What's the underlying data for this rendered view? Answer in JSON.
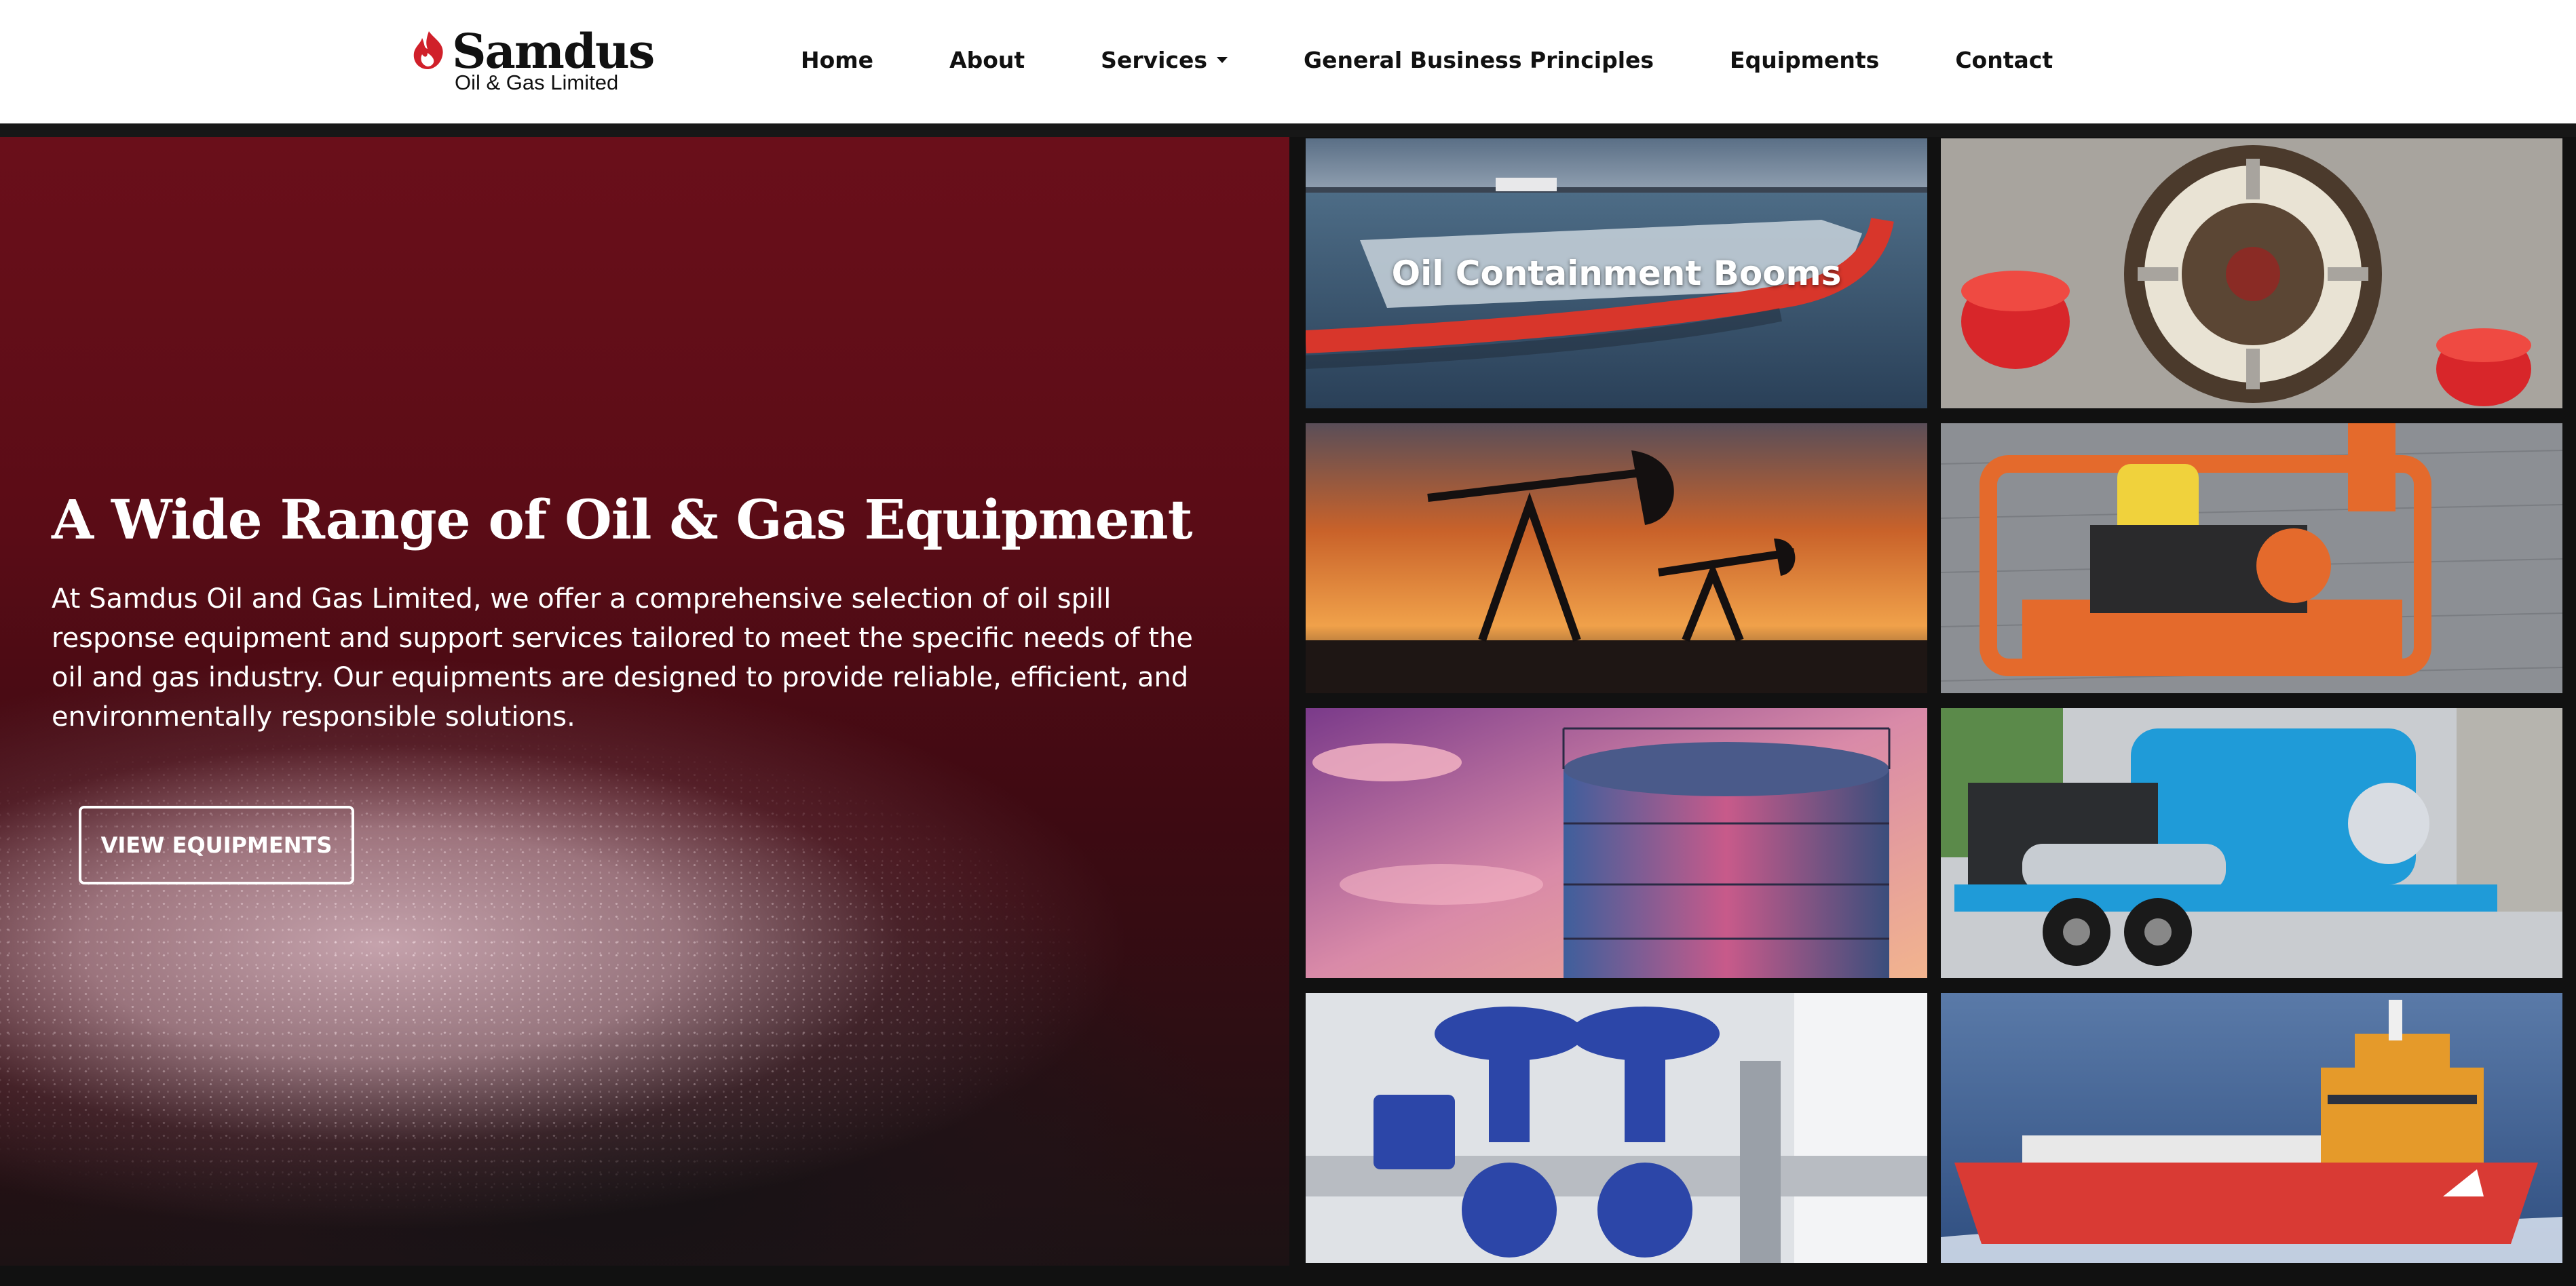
{
  "header": {
    "logo": {
      "name": "Samdus",
      "tagline": "Oil & Gas Limited"
    },
    "nav": [
      {
        "label": "Home"
      },
      {
        "label": "About"
      },
      {
        "label": "Services"
      },
      {
        "label": "General Business Principles"
      },
      {
        "label": "Equipments"
      },
      {
        "label": "Contact"
      }
    ]
  },
  "hero": {
    "title": "A Wide Range of Oil & Gas Equipment",
    "text": "At Samdus Oil and Gas Limited, we offer a comprehensive selection of oil spill response equipment and support services tailored to meet the specific needs of the oil and gas industry. Our equipments are designed to provide reliable, efficient, and environmentally responsible solutions.",
    "button_label": "VIEW EQUIPMENTS"
  },
  "gallery": [
    {
      "caption": "Oil Containment Booms"
    }
  ],
  "colors": {
    "brand_red": "#d0202a",
    "hero_red": "#5a0c16",
    "header_bg": "#ffffff"
  }
}
